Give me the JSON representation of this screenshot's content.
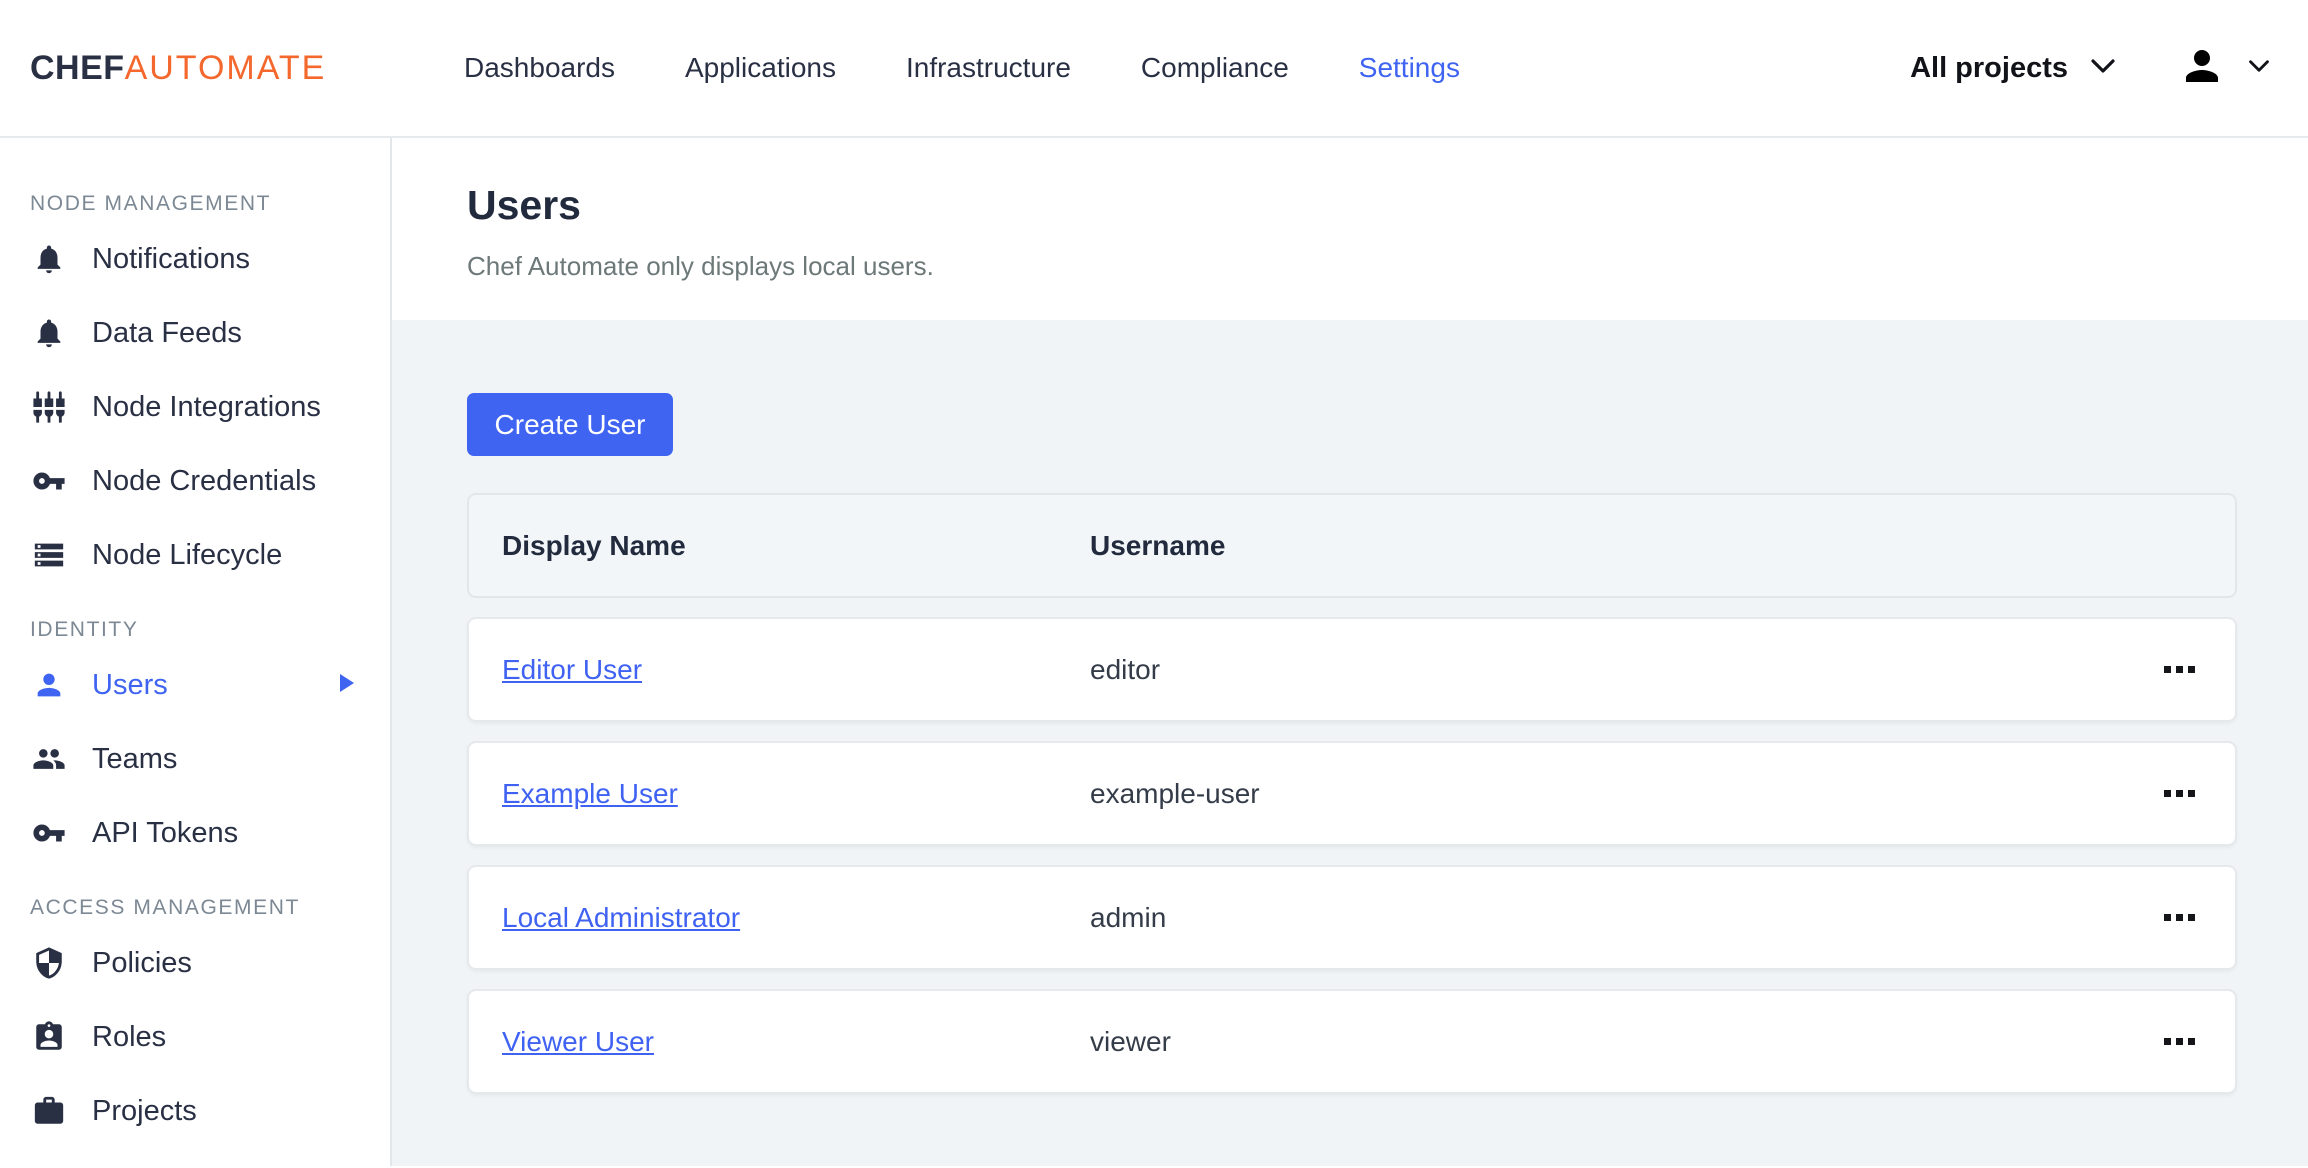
{
  "brand": {
    "chef": "CHEF",
    "automate": "AUTOMATE"
  },
  "nav": {
    "items": [
      {
        "label": "Dashboards",
        "active": false
      },
      {
        "label": "Applications",
        "active": false
      },
      {
        "label": "Infrastructure",
        "active": false
      },
      {
        "label": "Compliance",
        "active": false
      },
      {
        "label": "Settings",
        "active": true
      }
    ]
  },
  "topbar_right": {
    "projects_label": "All projects"
  },
  "sidebar": {
    "sections": [
      {
        "heading": "NODE MANAGEMENT",
        "items": [
          {
            "label": "Notifications",
            "icon": "bell-icon"
          },
          {
            "label": "Data Feeds",
            "icon": "bell-icon"
          },
          {
            "label": "Node Integrations",
            "icon": "plugs-icon"
          },
          {
            "label": "Node Credentials",
            "icon": "key-icon"
          },
          {
            "label": "Node Lifecycle",
            "icon": "storage-icon"
          }
        ]
      },
      {
        "heading": "IDENTITY",
        "items": [
          {
            "label": "Users",
            "icon": "person-icon",
            "active": true
          },
          {
            "label": "Teams",
            "icon": "group-icon"
          },
          {
            "label": "API Tokens",
            "icon": "key-icon"
          }
        ]
      },
      {
        "heading": "ACCESS MANAGEMENT",
        "items": [
          {
            "label": "Policies",
            "icon": "shield-icon"
          },
          {
            "label": "Roles",
            "icon": "badge-icon"
          },
          {
            "label": "Projects",
            "icon": "briefcase-icon"
          }
        ]
      }
    ]
  },
  "page": {
    "title": "Users",
    "subtitle": "Chef Automate only displays local users.",
    "create_button": "Create User"
  },
  "table": {
    "columns": [
      "Display Name",
      "Username"
    ],
    "rows": [
      {
        "display_name": "Editor User",
        "username": "editor"
      },
      {
        "display_name": "Example User",
        "username": "example-user"
      },
      {
        "display_name": "Local Administrator",
        "username": "admin"
      },
      {
        "display_name": "Viewer User",
        "username": "viewer"
      }
    ]
  },
  "colors": {
    "accent_blue": "#3f64f2",
    "brand_orange": "#f4682d",
    "dark_navy": "#2a3044",
    "page_background": "#f0f4f7"
  }
}
